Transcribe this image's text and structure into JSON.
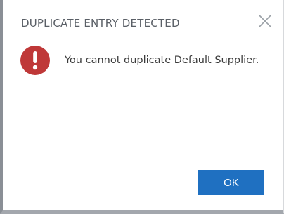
{
  "dialog": {
    "title": "DUPLICATE ENTRY DETECTED",
    "message": "You cannot duplicate Default Supplier.",
    "ok_label": "OK",
    "icons": {
      "close": "close-icon",
      "error": "error-icon"
    },
    "colors": {
      "error_red": "#bf3838",
      "button_blue": "#1f70c1",
      "title_gray": "#5a5f66"
    }
  }
}
